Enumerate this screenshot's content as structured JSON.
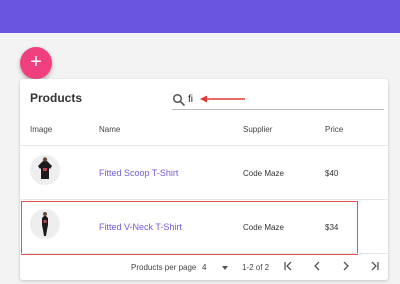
{
  "card": {
    "title": "Products"
  },
  "search": {
    "value": "fi"
  },
  "table": {
    "headers": [
      "Image",
      "Name",
      "Supplier",
      "Price"
    ],
    "rows": [
      {
        "name": "Fitted Scoop T-Shirt",
        "supplier": "Code Maze",
        "price": "$40"
      },
      {
        "name": "Fitted V-Neck T-Shirt",
        "supplier": "Code Maze",
        "price": "$34"
      }
    ]
  },
  "pagination": {
    "per_page_label": "Products per page",
    "per_page_value": "4",
    "range": "1-2 of 2",
    "first_icon": "first-page-icon",
    "prev_icon": "chevron-left-icon",
    "next_icon": "chevron-right-icon",
    "last_icon": "last-page-icon"
  },
  "colors": {
    "appbar": "#6a55e0",
    "fab": "#ef3f7f",
    "link": "#6c5ce0",
    "highlight": "#e55050"
  }
}
